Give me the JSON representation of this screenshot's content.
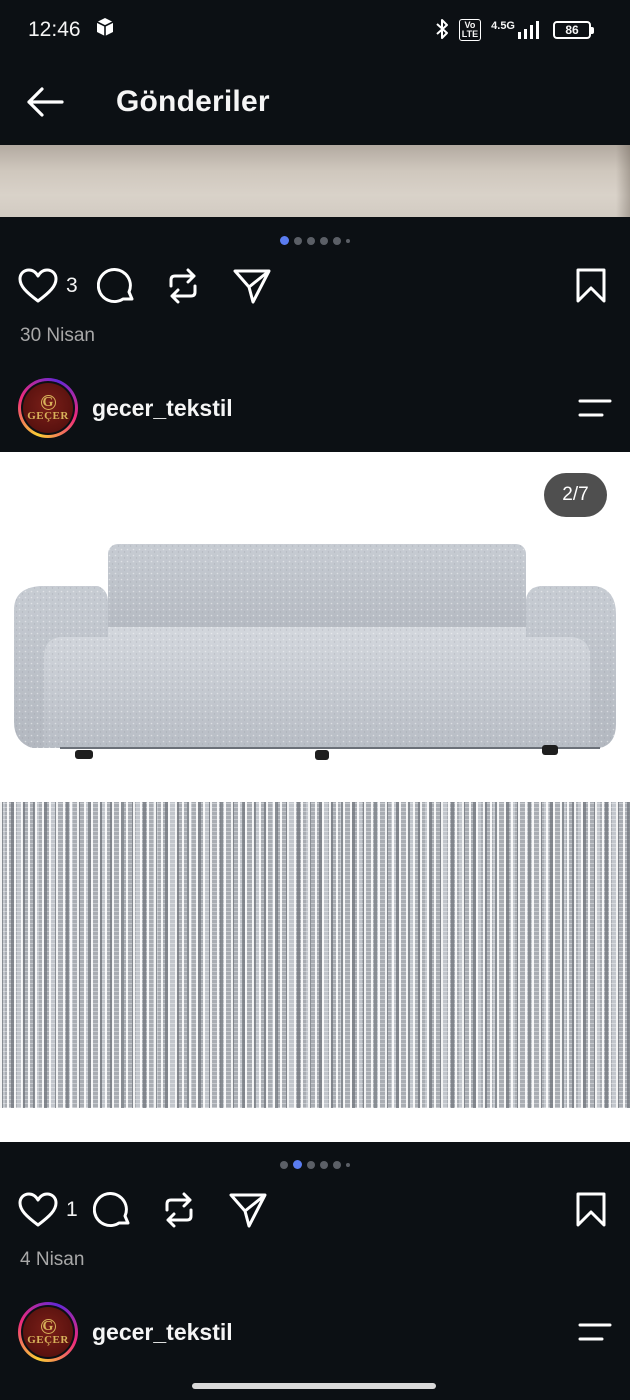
{
  "status": {
    "time": "12:46",
    "network": "4.5G",
    "volte_top": "Vo",
    "volte_bottom": "LTE",
    "battery": "86"
  },
  "header": {
    "title": "Gönderiler"
  },
  "posts": [
    {
      "likes": "3",
      "date": "30 Nisan"
    },
    {
      "username": "gecer_tekstil",
      "avatar_text": "GEÇER",
      "avatar_letter": "G",
      "image_counter": "2/7",
      "likes": "1",
      "date": "4 Nisan"
    },
    {
      "username": "gecer_tekstil",
      "avatar_text": "GEÇER",
      "avatar_letter": "G"
    }
  ],
  "colors": {
    "background": "#0c1014",
    "active_dot": "#5a7cf0",
    "muted_text": "#a8a8a8"
  },
  "icons": [
    "back-arrow-icon",
    "heart-icon",
    "comment-icon",
    "repost-icon",
    "share-icon",
    "bookmark-icon",
    "menu-icon"
  ]
}
